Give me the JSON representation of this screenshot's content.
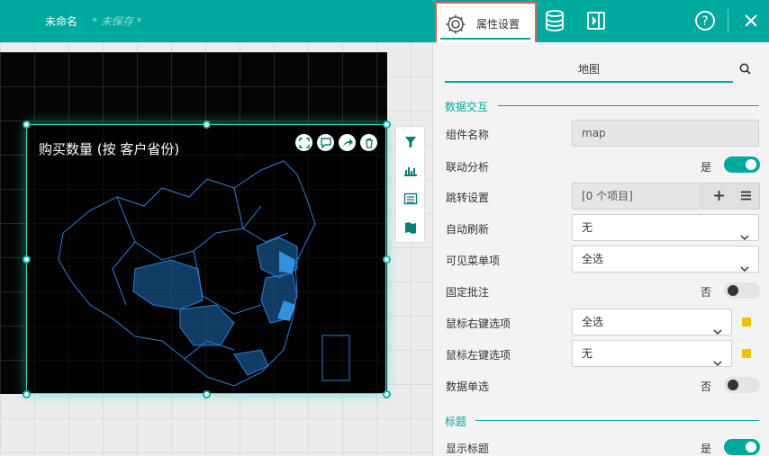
{
  "header": {
    "doc_name": "未命名",
    "doc_status": "* 未保存 *",
    "tab_properties": "属性设置",
    "icons": [
      "gear-icon",
      "database-icon",
      "panel-toggle-icon",
      "help-icon",
      "close-icon"
    ]
  },
  "widget": {
    "title": "购买数量 (按 客户省份)",
    "tool_icons": [
      "fullscreen-icon",
      "comment-icon",
      "share-icon",
      "delete-icon"
    ],
    "side_tools": [
      "filter-icon",
      "chart-analysis-icon",
      "table-icon",
      "map-icon"
    ]
  },
  "panel": {
    "tab": "地图",
    "section_interaction": "数据交互",
    "section_title": "标题",
    "rows": {
      "component_name": {
        "label": "组件名称",
        "value": "map"
      },
      "linkage": {
        "label": "联动分析",
        "state_text": "是"
      },
      "jump": {
        "label": "跳转设置",
        "value": "[0 个项目]"
      },
      "auto_refresh": {
        "label": "自动刷新",
        "value": "无"
      },
      "visible_menu": {
        "label": "可见菜单项",
        "value": "全选"
      },
      "fixed_note": {
        "label": "固定批注",
        "state_text": "否"
      },
      "right_click": {
        "label": "鼠标右键选项",
        "value": "全选"
      },
      "left_click": {
        "label": "鼠标左键选项",
        "value": "无"
      },
      "single_select": {
        "label": "数据单选",
        "state_text": "否"
      },
      "show_title": {
        "label": "显示标题",
        "state_text": "是"
      }
    },
    "colors": {
      "accent": "#00a99d",
      "marker": "#f2c200"
    }
  }
}
